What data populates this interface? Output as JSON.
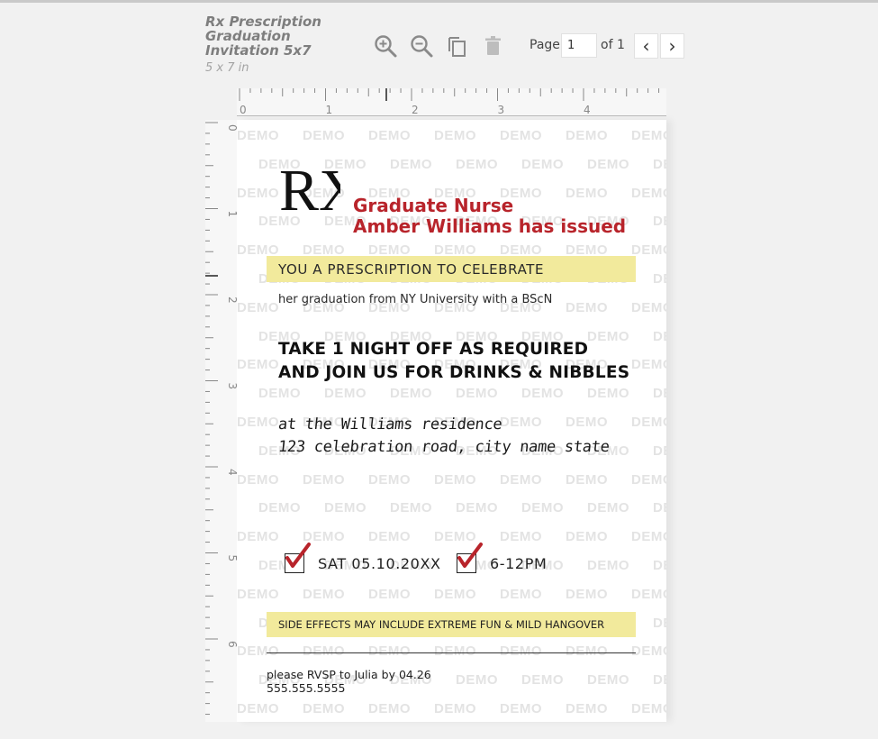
{
  "document": {
    "title": "Rx Prescription Graduation Invitation 5x7",
    "size": "5 x 7 in"
  },
  "toolbar": {
    "zoom_in_icon": "zoom-in-icon",
    "zoom_out_icon": "zoom-out-icon",
    "copy_icon": "copy-icon",
    "delete_icon": "trash-icon"
  },
  "pager": {
    "label": "Page",
    "current": "1",
    "total_label": "of 1",
    "prev": "‹",
    "next": "›"
  },
  "ruler": {
    "horizontal_labels": [
      "0",
      "1",
      "2",
      "3",
      "4"
    ],
    "vertical_labels": [
      "0",
      "1",
      "2",
      "3",
      "4",
      "5",
      "6"
    ]
  },
  "watermark": "DEMO",
  "invitation": {
    "logo": "RX",
    "headline_1": "Graduate Nurse",
    "headline_2": "Amber Williams has issued",
    "band_1": "YOU A PRESCRIPTION TO CELEBRATE",
    "subline": "her graduation from NY University with a BScN",
    "bold_1": "TAKE 1 NIGHT OFF AS REQUIRED",
    "bold_2": "AND JOIN US FOR DRINKS & NIBBLES",
    "script_1": "at the Williams residence",
    "script_2": "123 celebration road, city name state",
    "date": "SAT 05.10.20XX",
    "time": "6-12PM",
    "band_2": "SIDE EFFECTS MAY INCLUDE EXTREME FUN & MILD HANGOVER",
    "rsvp_1": "please RVSP to Julia by 04.26",
    "rsvp_2": "555.555.5555"
  },
  "colors": {
    "accent_red": "#b8242b",
    "highlight_yellow": "#f2ea9c",
    "watermark_grey": "#e3e3e3"
  }
}
